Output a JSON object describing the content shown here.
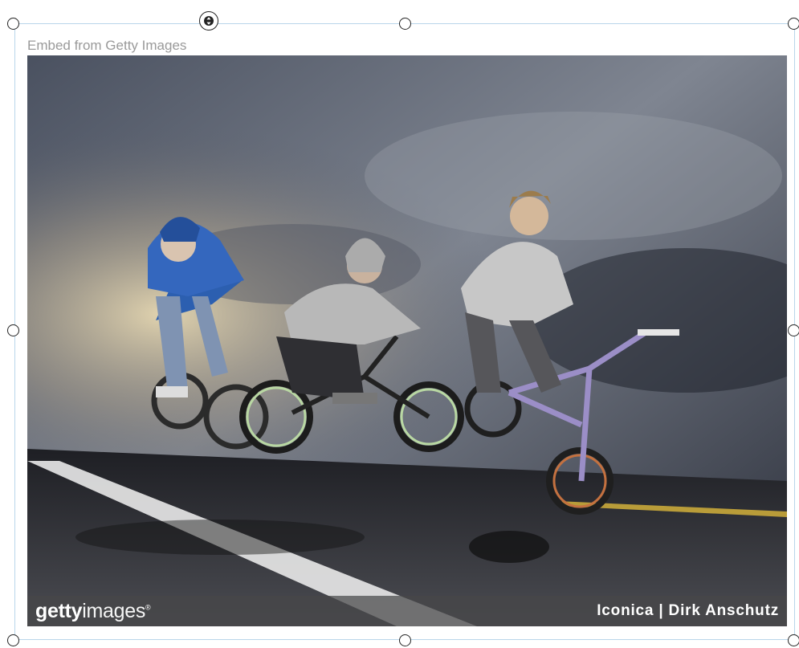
{
  "embed": {
    "label": "Embed from Getty Images"
  },
  "photo": {
    "description_icon": "bmx-photo",
    "footer": {
      "logo_bold": "getty",
      "logo_light": "images",
      "logo_mark": "®",
      "credit": "Iconica | Dirk Anschutz"
    }
  },
  "handles": {
    "rotate_icon": "rotate-arrows-icon"
  },
  "colors": {
    "frame_border": "#b9d6ea",
    "label_gray": "#9a9a9a"
  }
}
